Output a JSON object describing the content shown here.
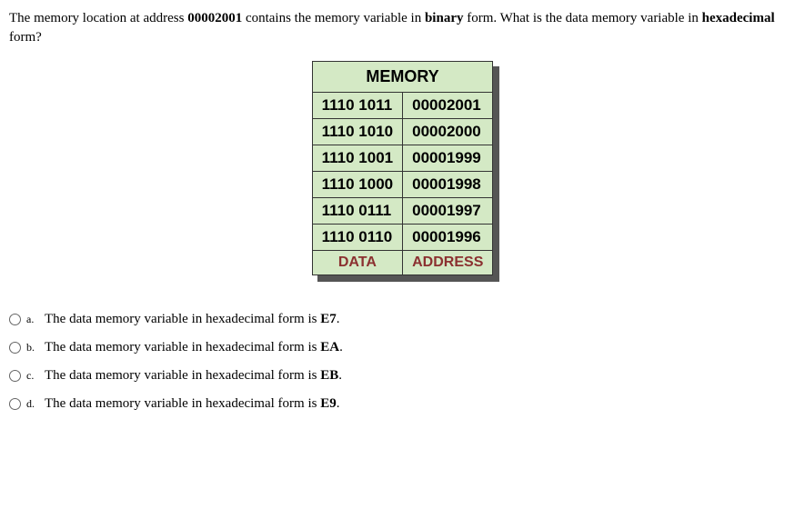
{
  "question": {
    "part1": "The memory location at address ",
    "address": "00002001",
    "part2": " contains the memory variable in ",
    "form1": "binary",
    "part3": " form. What is the data memory variable in ",
    "form2": "hexadecimal",
    "part4": " form?"
  },
  "memory": {
    "title": "MEMORY",
    "rows": [
      {
        "data": "1110 1011",
        "address": "00002001"
      },
      {
        "data": "1110 1010",
        "address": "00002000"
      },
      {
        "data": "1110 1001",
        "address": "00001999"
      },
      {
        "data": "1110 1000",
        "address": "00001998"
      },
      {
        "data": "1110 0111",
        "address": "00001997"
      },
      {
        "data": "1110 0110",
        "address": "00001996"
      }
    ],
    "footer": {
      "data": "DATA",
      "address": "ADDRESS"
    }
  },
  "options": [
    {
      "letter": "a.",
      "text": "The data memory variable in hexadecimal form is ",
      "value": "E7",
      "suffix": "."
    },
    {
      "letter": "b.",
      "text": "The data memory variable in hexadecimal form is ",
      "value": "EA",
      "suffix": "."
    },
    {
      "letter": "c.",
      "text": "The data memory variable in hexadecimal form is ",
      "value": "EB",
      "suffix": "."
    },
    {
      "letter": "d.",
      "text": "The data memory variable in hexadecimal form is ",
      "value": "E9",
      "suffix": "."
    }
  ]
}
